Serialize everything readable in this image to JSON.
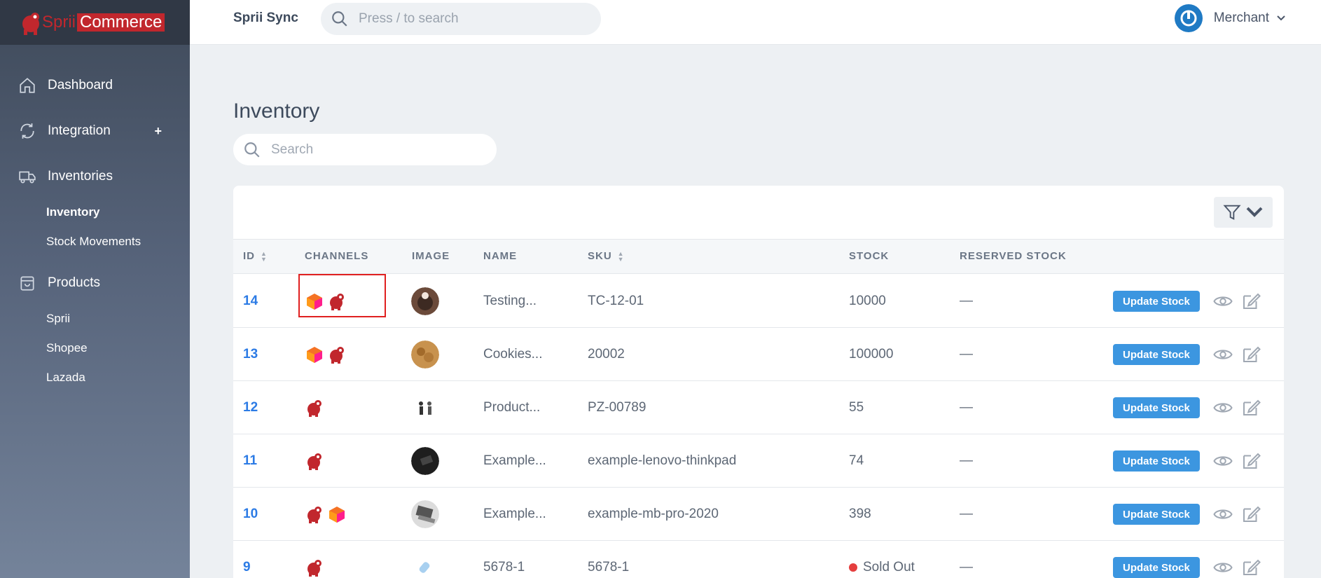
{
  "brand": {
    "name_part1": "Sprii",
    "name_part2": "Commerce"
  },
  "header": {
    "app_name": "Sprii Sync",
    "search_placeholder": "Press / to search",
    "user_label": "Merchant"
  },
  "sidebar": {
    "items": [
      {
        "label": "Dashboard",
        "icon": "home-icon"
      },
      {
        "label": "Integration",
        "icon": "refresh-icon",
        "plus": "+"
      },
      {
        "label": "Inventories",
        "icon": "truck-icon"
      },
      {
        "label": "Products",
        "icon": "box-icon"
      }
    ],
    "inventories_sub": [
      "Inventory",
      "Stock Movements"
    ],
    "products_sub": [
      "Sprii",
      "Shopee",
      "Lazada"
    ]
  },
  "main": {
    "title": "Inventory",
    "search_placeholder": "Search",
    "columns": [
      "ID",
      "CHANNELS",
      "IMAGE",
      "NAME",
      "SKU",
      "STOCK",
      "RESERVED STOCK"
    ],
    "update_label": "Update Stock",
    "rows": [
      {
        "id": "14",
        "channels": [
          "lazada",
          "sprii"
        ],
        "name": "Testing...",
        "sku": "TC-12-01",
        "stock": "10000",
        "reserved": "—"
      },
      {
        "id": "13",
        "channels": [
          "lazada",
          "sprii"
        ],
        "name": "Cookies...",
        "sku": "20002",
        "stock": "100000",
        "reserved": "—"
      },
      {
        "id": "12",
        "channels": [
          "sprii"
        ],
        "name": "Product...",
        "sku": "PZ-00789",
        "stock": "55",
        "reserved": "—"
      },
      {
        "id": "11",
        "channels": [
          "sprii"
        ],
        "name": "Example...",
        "sku": "example-lenovo-thinkpad",
        "stock": "74",
        "reserved": "—"
      },
      {
        "id": "10",
        "channels": [
          "sprii",
          "lazada"
        ],
        "name": "Example...",
        "sku": "example-mb-pro-2020",
        "stock": "398",
        "reserved": "—"
      },
      {
        "id": "9",
        "channels": [
          "sprii"
        ],
        "name": "5678-1",
        "sku": "5678-1",
        "stock": "Sold Out",
        "reserved": "—"
      }
    ]
  },
  "colors": {
    "accent": "#2c7be5",
    "button": "#3c96e0",
    "brand_red": "#c1272d",
    "sold_out": "#e53e3e"
  }
}
